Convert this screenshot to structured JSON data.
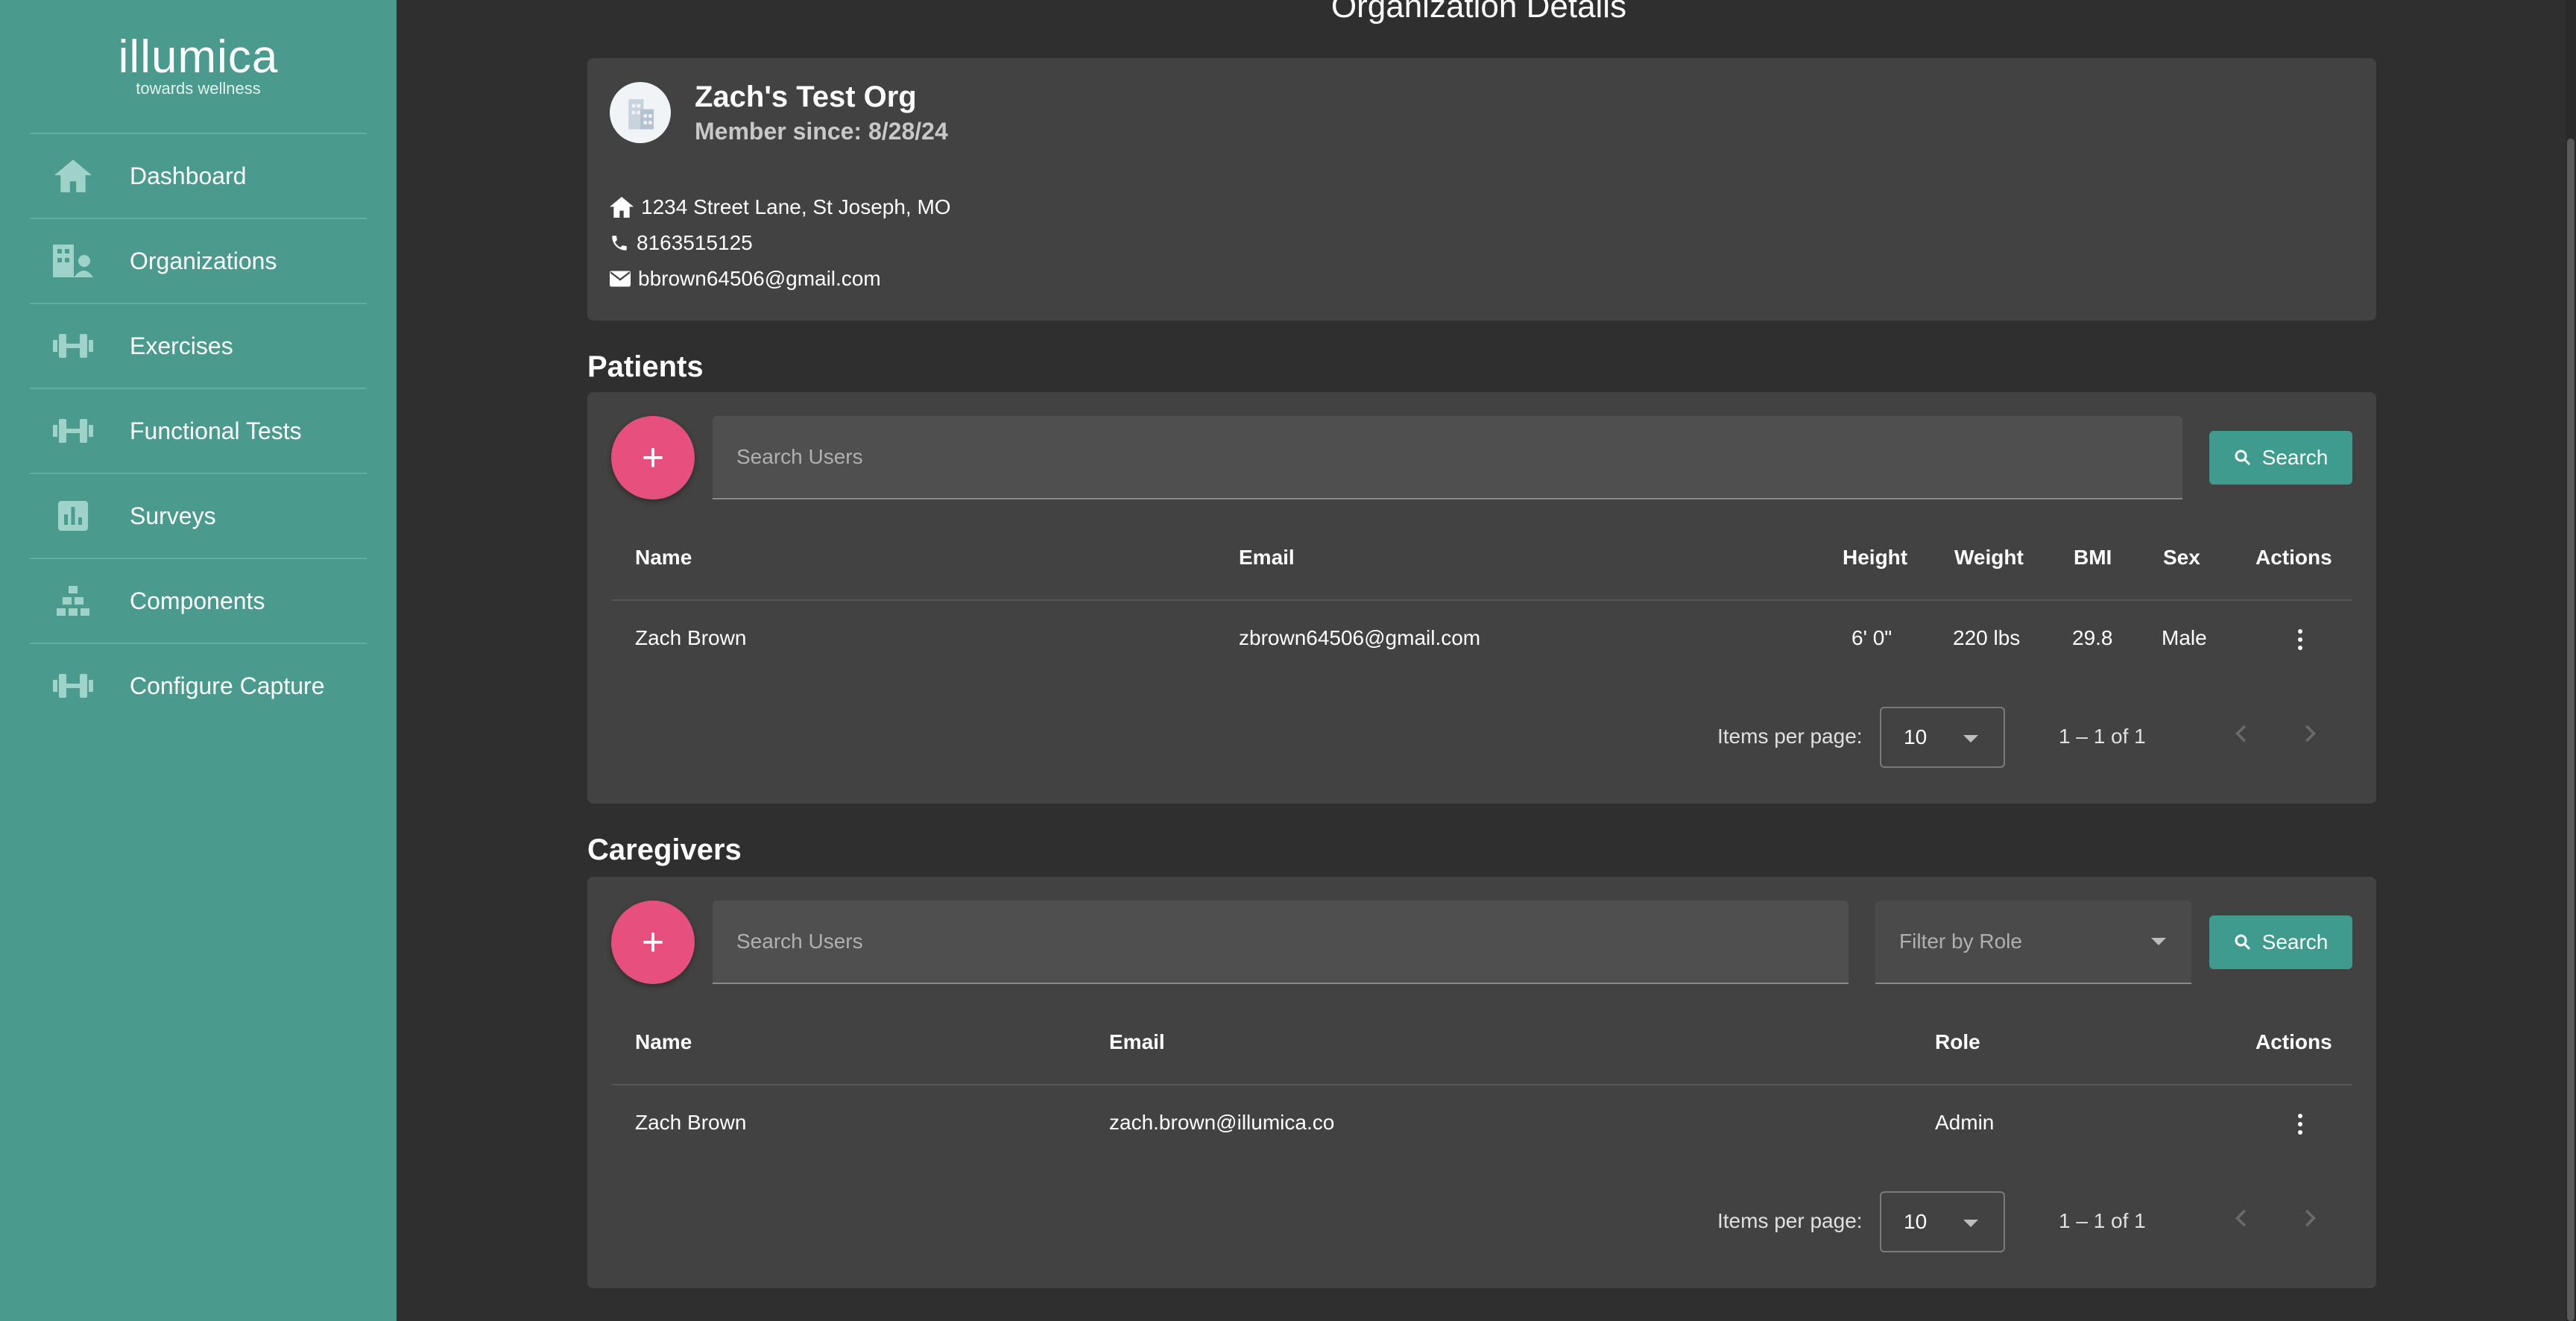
{
  "brand": {
    "name": "illumica",
    "tagline": "towards wellness"
  },
  "sidebar": {
    "items": [
      {
        "label": "Dashboard",
        "icon": "home-icon"
      },
      {
        "label": "Organizations",
        "icon": "organization-icon"
      },
      {
        "label": "Exercises",
        "icon": "dumbbell-icon"
      },
      {
        "label": "Functional Tests",
        "icon": "dumbbell-icon"
      },
      {
        "label": "Surveys",
        "icon": "poll-icon"
      },
      {
        "label": "Components",
        "icon": "components-icon"
      },
      {
        "label": "Configure Capture",
        "icon": "dumbbell-icon"
      }
    ]
  },
  "page": {
    "title": "Organization Details"
  },
  "org": {
    "name": "Zach's Test Org",
    "member_since": "Member since: 8/28/24",
    "address": "1234 Street Lane, St Joseph, MO",
    "phone": "8163515125",
    "email": "bbrown64506@gmail.com"
  },
  "patients": {
    "title": "Patients",
    "search_placeholder": "Search Users",
    "search_label": "Search",
    "columns": [
      "Name",
      "Email",
      "Height",
      "Weight",
      "BMI",
      "Sex",
      "Actions"
    ],
    "rows": [
      {
        "name": "Zach Brown",
        "email": "zbrown64506@gmail.com",
        "height": "6' 0\"",
        "weight": "220 lbs",
        "bmi": "29.8",
        "sex": "Male"
      }
    ],
    "items_per_page_label": "Items per page:",
    "items_per_page": "10",
    "range": "1 – 1 of 1"
  },
  "caregivers": {
    "title": "Caregivers",
    "search_placeholder": "Search Users",
    "filter_placeholder": "Filter by Role",
    "search_label": "Search",
    "columns": [
      "Name",
      "Email",
      "Role",
      "Actions"
    ],
    "rows": [
      {
        "name": "Zach Brown",
        "email": "zach.brown@illumica.co",
        "role": "Admin"
      }
    ],
    "items_per_page_label": "Items per page:",
    "items_per_page": "10",
    "range": "1 – 1 of 1"
  },
  "colors": {
    "sidebar": "#4a9a8e",
    "accent": "#3f9b8d",
    "fab": "#e7507e",
    "background": "#2f2f2f",
    "card": "#424242"
  }
}
